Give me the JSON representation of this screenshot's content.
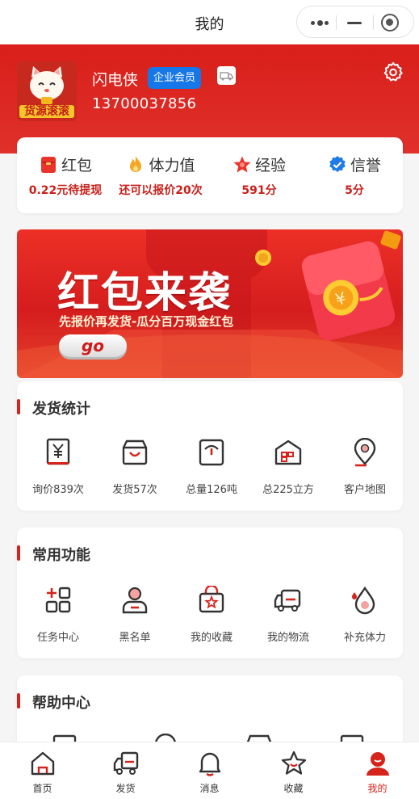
{
  "nav": {
    "title": "我的"
  },
  "profile": {
    "avatar_text": "货源滚滚",
    "name": "闪电侠",
    "member_badge": "企业会员",
    "phone": "13700037856"
  },
  "stats": [
    {
      "label": "红包",
      "value": "0.22元待提现",
      "icon": "red-envelope-icon"
    },
    {
      "label": "体力值",
      "value": "还可以报价20次",
      "icon": "flame-icon"
    },
    {
      "label": "经验",
      "value": "591分",
      "icon": "star-icon"
    },
    {
      "label": "信誉",
      "value": "5分",
      "icon": "shield-check-icon"
    }
  ],
  "banner": {
    "title": "红包来袭",
    "subtitle": "先报价再发货-瓜分百万现金红包",
    "button": "go"
  },
  "shipping_stats": {
    "title": "发货统计",
    "items": [
      {
        "label": "询价839次",
        "icon": "ledger-icon"
      },
      {
        "label": "发货57次",
        "icon": "bag-icon"
      },
      {
        "label": "总量126吨",
        "icon": "scale-icon"
      },
      {
        "label": "总225立方",
        "icon": "warehouse-icon"
      },
      {
        "label": "客户地图",
        "icon": "map-pin-icon"
      }
    ]
  },
  "common_functions": {
    "title": "常用功能",
    "items": [
      {
        "label": "任务中心",
        "icon": "task-grid-icon"
      },
      {
        "label": "黑名单",
        "icon": "user-block-icon"
      },
      {
        "label": "我的收藏",
        "icon": "favorite-bag-icon"
      },
      {
        "label": "我的物流",
        "icon": "delivery-truck-icon"
      },
      {
        "label": "补充体力",
        "icon": "drop-icon"
      }
    ]
  },
  "help_center": {
    "title": "帮助中心"
  },
  "tabbar": [
    {
      "label": "首页",
      "icon": "home-icon"
    },
    {
      "label": "发货",
      "icon": "truck-icon"
    },
    {
      "label": "消息",
      "icon": "bell-icon"
    },
    {
      "label": "收藏",
      "icon": "star-outline-icon"
    },
    {
      "label": "我的",
      "icon": "user-icon",
      "active": true
    }
  ],
  "colors": {
    "brand_red": "#d6231b",
    "member_blue": "#1677e8"
  }
}
